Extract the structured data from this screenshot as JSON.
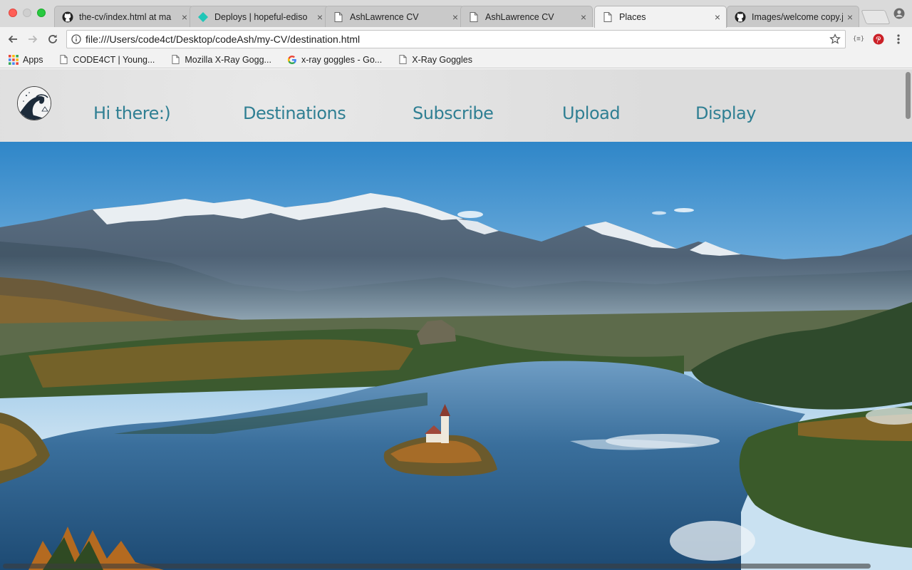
{
  "browser": {
    "tabs": [
      {
        "title": "the-cv/index.html at ma",
        "favicon": "github-icon",
        "active": false
      },
      {
        "title": "Deploys | hopeful-ediso",
        "favicon": "netlify-icon",
        "active": false
      },
      {
        "title": "AshLawrence CV",
        "favicon": "document-icon",
        "active": false
      },
      {
        "title": "AshLawrence CV",
        "favicon": "document-icon",
        "active": false
      },
      {
        "title": "Places",
        "favicon": "document-icon",
        "active": true
      },
      {
        "title": "Images/welcome copy.jp",
        "favicon": "github-icon",
        "active": false
      }
    ],
    "close_glyph": "×",
    "url": "file:///Users/code4ct/Desktop/codeAsh/my-CV/destination.html",
    "extension_label": "{≡}",
    "bookmarks": [
      {
        "label": "Apps",
        "icon": "apps-grid-icon"
      },
      {
        "label": "CODE4CT | Young...",
        "icon": "document-icon"
      },
      {
        "label": "Mozilla X-Ray Gogg...",
        "icon": "document-icon"
      },
      {
        "label": "x-ray goggles - Go...",
        "icon": "google-icon"
      },
      {
        "label": "X-Ray Goggles",
        "icon": "document-icon"
      }
    ]
  },
  "site": {
    "logo": "great-wave-logo",
    "nav": [
      {
        "label": "Hi there:)"
      },
      {
        "label": "Destinations"
      },
      {
        "label": "Subscribe"
      },
      {
        "label": "Upload"
      },
      {
        "label": "Display"
      }
    ],
    "hero_image": "lake-bled-mountain-landscape"
  },
  "colors": {
    "nav_link": "#2f7f93",
    "nav_background": "#dedede",
    "sky_top": "#2f86c8",
    "lake": "#2a5f8e"
  }
}
